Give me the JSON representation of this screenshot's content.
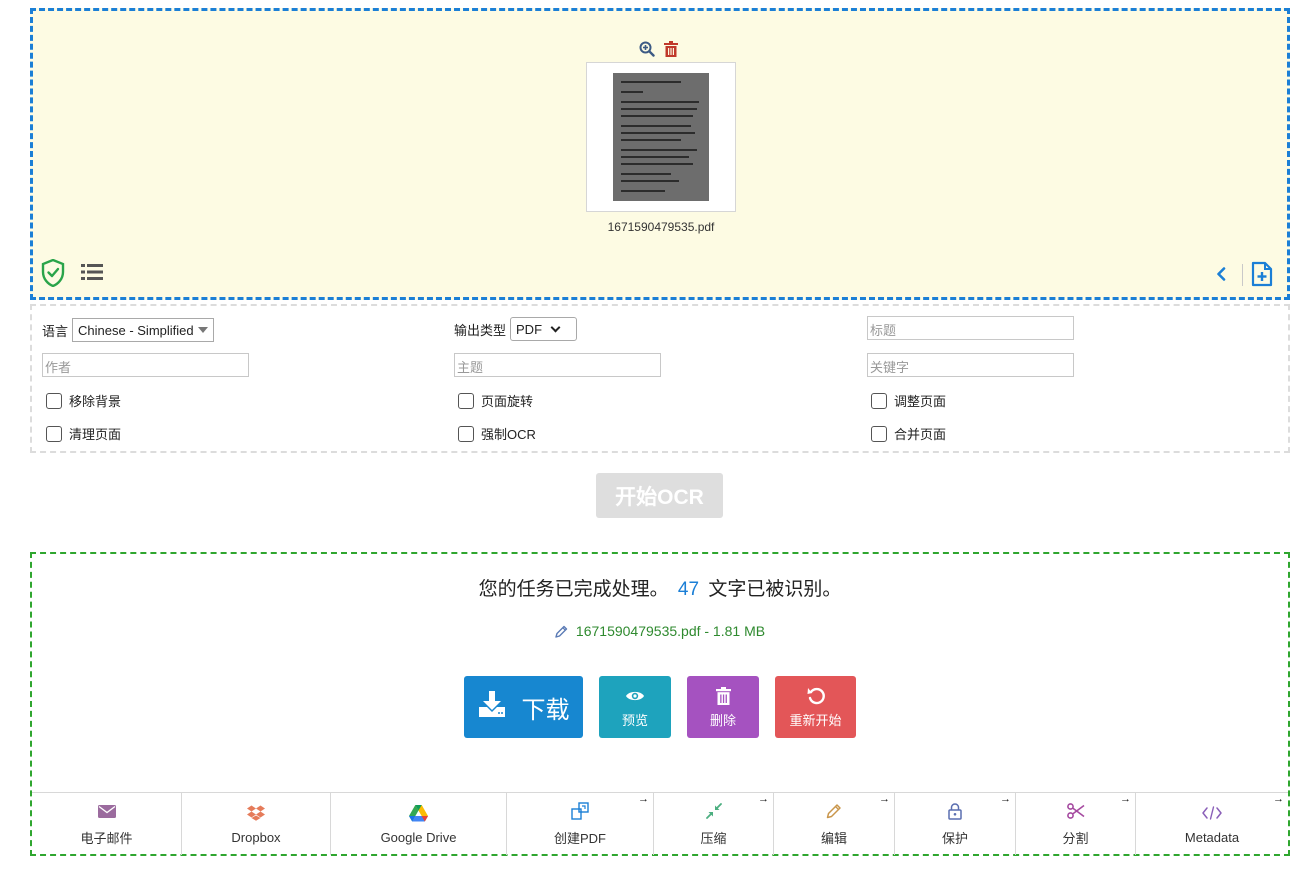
{
  "upload": {
    "file_name": "1671590479535.pdf",
    "icons": {
      "zoom": "zoom-in-icon",
      "delete": "trash-icon",
      "security": "shield-check-icon",
      "list": "list-icon",
      "collapse": "chevron-left-icon",
      "add": "add-file-icon"
    },
    "colors": {
      "zone_bg": "#fdfbe3",
      "zone_border": "#1b7fd6"
    }
  },
  "options": {
    "language_label": "语言",
    "language_value": "Chinese - Simplified",
    "output_type_label": "输出类型",
    "output_type_value": "PDF",
    "title_placeholder": "标题",
    "author_placeholder": "作者",
    "subject_placeholder": "主题",
    "keywords_placeholder": "关键字",
    "checkboxes": {
      "remove_background": "移除背景",
      "rotate_pages": "页面旋转",
      "deskew_pages": "调整页面",
      "clean_pages": "清理页面",
      "force_ocr": "强制OCR",
      "merge_pages": "合并页面"
    }
  },
  "start_button": "开始OCR",
  "result": {
    "message_before": "您的任务已完成处理。",
    "count": "47",
    "message_after": "文字已被识别。",
    "file_info": "1671590479535.pdf - 1.81 MB",
    "buttons": {
      "download": "下载",
      "preview": "预览",
      "delete": "删除",
      "restart": "重新开始"
    },
    "colors": {
      "download": "#1787d0",
      "preview": "#1ea3bd",
      "delete": "#a552c0",
      "restart": "#e35658",
      "border": "#2fa62f"
    }
  },
  "tools": [
    {
      "label": "电子邮件",
      "icon": "envelope-icon",
      "color": "#9b6b9e"
    },
    {
      "label": "Dropbox",
      "icon": "dropbox-icon",
      "color": "#e57b5a"
    },
    {
      "label": "Google Drive",
      "icon": "google-drive-icon",
      "color": "#1a73e8"
    },
    {
      "label": "创建PDF",
      "icon": "create-pdf-icon",
      "color": "#1b7fd6"
    },
    {
      "label": "压缩",
      "icon": "compress-icon",
      "color": "#4caf80"
    },
    {
      "label": "编辑",
      "icon": "pencil-icon",
      "color": "#c9964b"
    },
    {
      "label": "保护",
      "icon": "lock-icon",
      "color": "#5a6eb0"
    },
    {
      "label": "分割",
      "icon": "scissors-icon",
      "color": "#a54aa0"
    },
    {
      "label": "Metadata",
      "icon": "code-icon",
      "color": "#8a5fb8"
    }
  ]
}
